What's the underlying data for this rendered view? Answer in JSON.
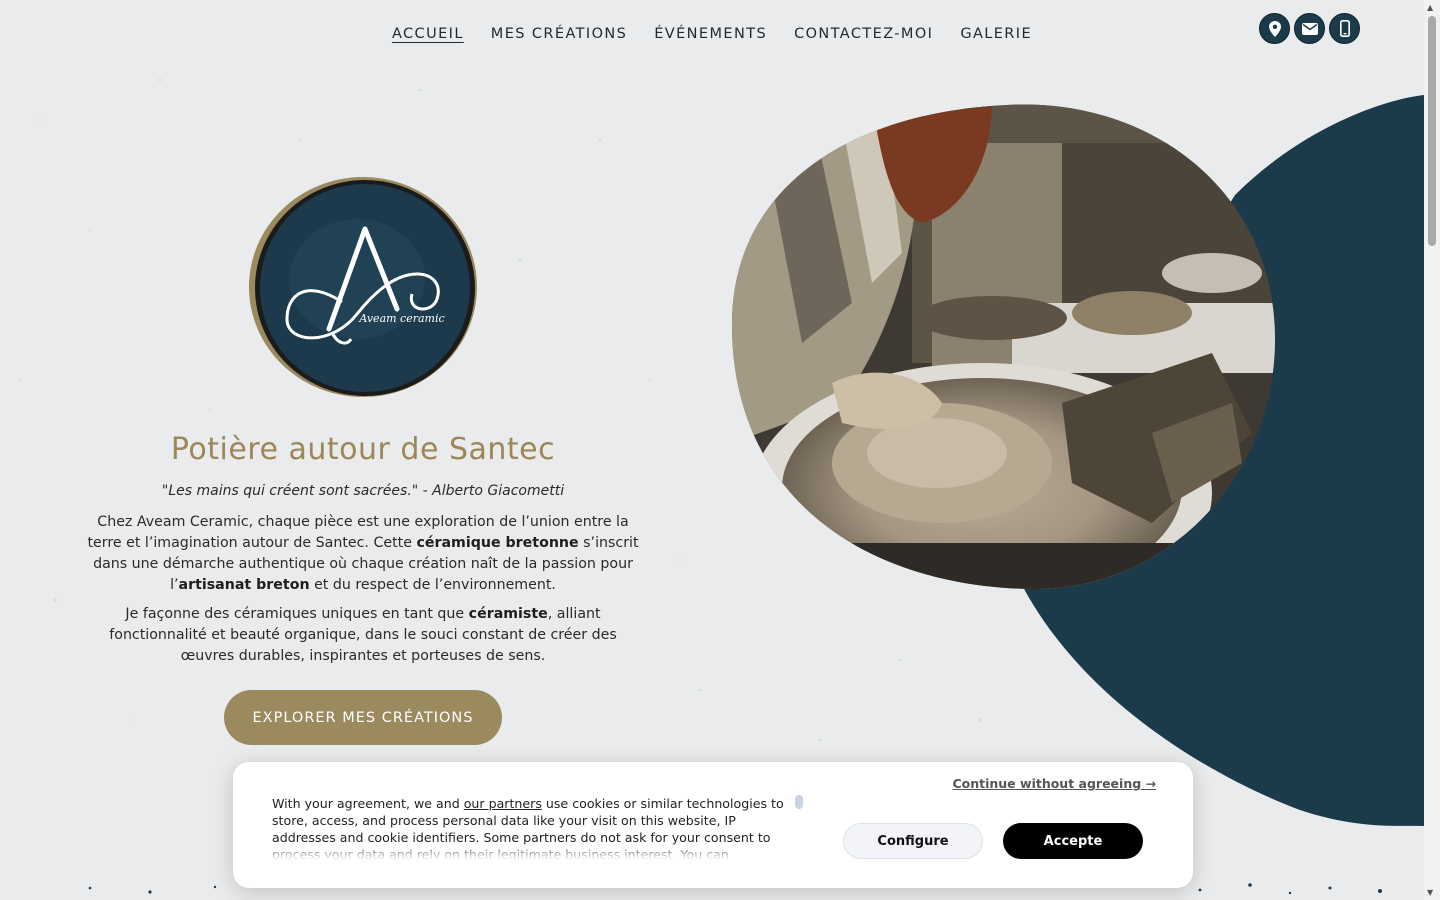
{
  "nav": {
    "items": [
      {
        "label": "ACCUEIL",
        "active": true
      },
      {
        "label": "MES CRÉATIONS",
        "active": false
      },
      {
        "label": "ÉVÉNEMENTS",
        "active": false
      },
      {
        "label": "CONTACTEZ-MOI",
        "active": false
      },
      {
        "label": "GALERIE",
        "active": false
      }
    ]
  },
  "contact_icons": [
    "location-pin-icon",
    "mail-icon",
    "phone-icon"
  ],
  "logo": {
    "text": "Aveam ceramic",
    "letter": "A"
  },
  "hero": {
    "title": "Potière autour de Santec",
    "quote": "\"Les mains qui créent sont sacrées.\" - Alberto Giacometti",
    "p1": {
      "a": "Chez Aveam Ceramic, chaque pièce est une exploration de l’union entre la terre et l’imagination autour de Santec. Cette ",
      "b1": "céramique bretonne",
      "c": " s’inscrit dans une démarche authentique où chaque création naît de la passion pour l’",
      "b2": "artisanat breton",
      "d": " et du respect de l’environnement."
    },
    "p2": {
      "a": "Je façonne des céramiques uniques en tant que ",
      "b1": "céramiste",
      "c": ", alliant fonctionnalité et beauté organique, dans le souci constant de créer des œuvres durables, inspirantes et porteuses de sens."
    },
    "cta": "EXPLORER MES CRÉATIONS"
  },
  "cookie": {
    "continue": "Continue without agreeing →",
    "text_a": "With your agreement, we and ",
    "partners_link": "our partners",
    "text_b": " use cookies or similar technologies to store, access, and process personal data like your visit on this website, IP addresses and cookie identifiers. Some partners do not ask for your consent to process your data and rely on their legitimate business interest. You can",
    "configure": "Configure",
    "accept": "Accepte"
  },
  "colors": {
    "accent": "#9a8a5d",
    "title": "#9c8758",
    "dark_blue": "#1b3a4a",
    "background": "#e9ebec"
  }
}
